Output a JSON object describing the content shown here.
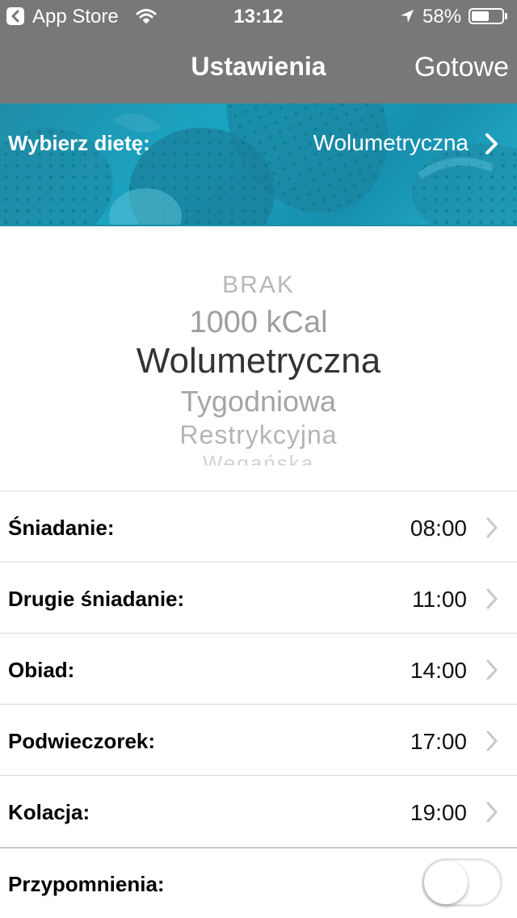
{
  "status_bar": {
    "back_app": "App Store",
    "time": "13:12",
    "battery_percent": "58%",
    "battery_level": 0.58
  },
  "nav": {
    "title": "Ustawienia",
    "done": "Gotowe"
  },
  "diet_banner": {
    "label": "Wybierz dietę:",
    "value": "Wolumetryczna"
  },
  "picker": {
    "options": [
      "BRAK",
      "1000 kCal",
      "Wolumetryczna",
      "Tygodniowa",
      "Restrykcyjna",
      "Wegańska"
    ],
    "selected": "Wolumetryczna"
  },
  "meals": [
    {
      "label": "Śniadanie:",
      "time": "08:00"
    },
    {
      "label": "Drugie śniadanie:",
      "time": "11:00"
    },
    {
      "label": "Obiad:",
      "time": "14:00"
    },
    {
      "label": "Podwieczorek:",
      "time": "17:00"
    },
    {
      "label": "Kolacja:",
      "time": "19:00"
    }
  ],
  "reminders": {
    "label": "Przypomnienia:",
    "enabled": false
  },
  "colors": {
    "nav_bg": "#787878",
    "banner_tint": "#1aa5c4"
  }
}
